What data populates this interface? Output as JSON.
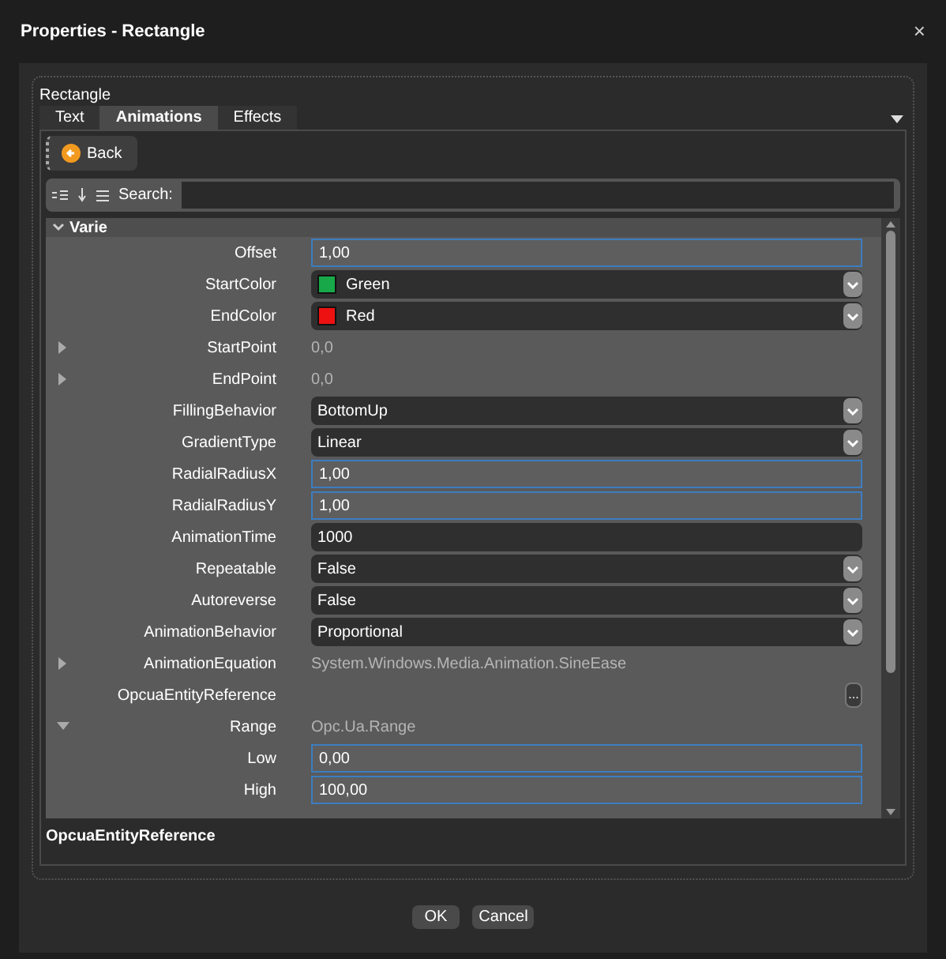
{
  "window": {
    "title": "Properties - Rectangle",
    "close": "×"
  },
  "object_name": "Rectangle",
  "tabs": [
    {
      "label": "Text",
      "selected": false
    },
    {
      "label": "Animations",
      "selected": true
    },
    {
      "label": "Effects",
      "selected": false
    }
  ],
  "back_button": "Back",
  "search": {
    "label": "Search:"
  },
  "category": {
    "name": "Varie",
    "expanded": true
  },
  "properties": [
    {
      "kind": "text",
      "name": "Offset",
      "value": "1,00"
    },
    {
      "kind": "color",
      "name": "StartColor",
      "value": "Green",
      "color": "#18a84a"
    },
    {
      "kind": "color",
      "name": "EndColor",
      "value": "Red",
      "color": "#ee1111"
    },
    {
      "kind": "readonly",
      "name": "StartPoint",
      "value": "0,0",
      "expanded": false
    },
    {
      "kind": "readonly",
      "name": "EndPoint",
      "value": "0,0",
      "expanded": false
    },
    {
      "kind": "dropdown",
      "name": "FillingBehavior",
      "value": "BottomUp"
    },
    {
      "kind": "dropdown",
      "name": "GradientType",
      "value": "Linear"
    },
    {
      "kind": "text",
      "name": "RadialRadiusX",
      "value": "1,00"
    },
    {
      "kind": "text",
      "name": "RadialRadiusY",
      "value": "1,00"
    },
    {
      "kind": "plain",
      "name": "AnimationTime",
      "value": "1000"
    },
    {
      "kind": "dropdown",
      "name": "Repeatable",
      "value": "False"
    },
    {
      "kind": "dropdown",
      "name": "Autoreverse",
      "value": "False"
    },
    {
      "kind": "dropdown",
      "name": "AnimationBehavior",
      "value": "Proportional"
    },
    {
      "kind": "readonly",
      "name": "AnimationEquation",
      "value": "System.Windows.Media.Animation.SineEase",
      "expanded": false
    },
    {
      "kind": "ellipsis",
      "name": "OpcuaEntityReference",
      "button": "..."
    },
    {
      "kind": "readonly",
      "name": "Range",
      "value": "Opc.Ua.Range",
      "expanded": true,
      "children": [
        {
          "kind": "text",
          "name": "Low",
          "value": "0,00"
        },
        {
          "kind": "text",
          "name": "High",
          "value": "100,00"
        }
      ]
    }
  ],
  "description": "OpcuaEntityReference",
  "buttons": [
    "OK",
    "Cancel"
  ]
}
